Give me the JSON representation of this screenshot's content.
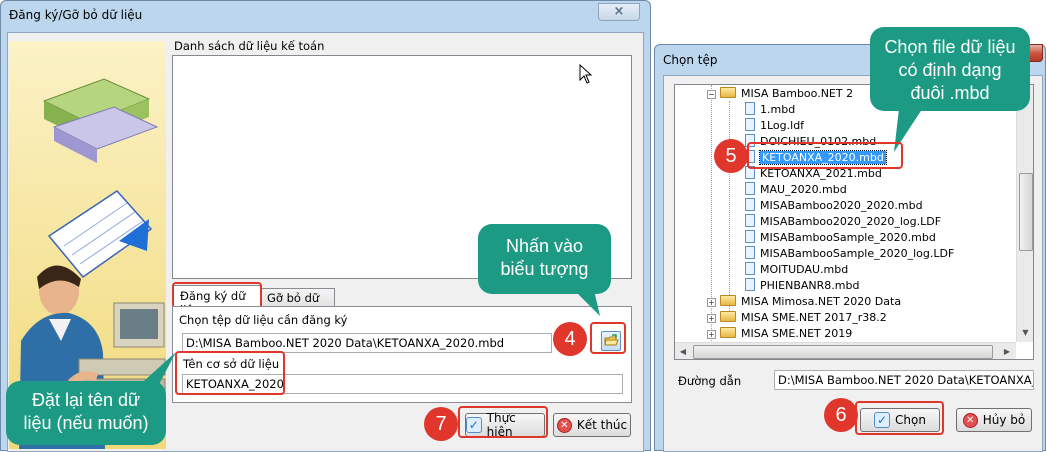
{
  "register_dialog": {
    "title": "Đăng ký/Gỡ bỏ dữ liệu",
    "close_icon": "×",
    "list_label": "Danh sách dữ liệu kế toán",
    "tabs": [
      {
        "label": "Đăng ký dữ liệu",
        "active": true
      },
      {
        "label": "Gỡ bỏ dữ liệu",
        "active": false
      }
    ],
    "file_field_label": "Chọn tệp dữ liệu cần đăng ký",
    "file_path_value": "D:\\MISA Bamboo.NET 2020 Data\\KETOANXA_2020.mbd",
    "db_name_label": "Tên cơ sở dữ liệu",
    "db_name_value": "KETOANXA_2020",
    "execute_button": "Thực hiện",
    "exit_button": "Kết thúc"
  },
  "choose_dialog": {
    "title": "Chọn tệp",
    "close_icon": "×",
    "tree": [
      {
        "label": "MISA Bamboo.NET 2",
        "type": "folder",
        "expander": "−"
      },
      {
        "label": "1.mbd",
        "type": "file"
      },
      {
        "label": "1Log.ldf",
        "type": "file"
      },
      {
        "label": "DOICHIEU_0102.mbd",
        "type": "file"
      },
      {
        "label": "KETOANXA_2020.mbd",
        "type": "file",
        "selected": true
      },
      {
        "label": "KETOANXA_2021.mbd",
        "type": "file"
      },
      {
        "label": "MAU_2020.mbd",
        "type": "file"
      },
      {
        "label": "MISABamboo2020_2020.mbd",
        "type": "file"
      },
      {
        "label": "MISABamboo2020_2020_log.LDF",
        "type": "file"
      },
      {
        "label": "MISABambooSample_2020.mbd",
        "type": "file"
      },
      {
        "label": "MISABambooSample_2020_log.LDF",
        "type": "file"
      },
      {
        "label": "MOITUDAU.mbd",
        "type": "file"
      },
      {
        "label": "PHIENBANR8.mbd",
        "type": "file"
      },
      {
        "label": "MISA Mimosa.NET 2020 Data",
        "type": "folder",
        "expander": "+"
      },
      {
        "label": "MISA SME.NET 2017_r38.2",
        "type": "folder",
        "expander": "+"
      },
      {
        "label": "MISA SME.NET 2019",
        "type": "folder",
        "expander": "+"
      }
    ],
    "path_label": "Đường dẫn",
    "path_value": "D:\\MISA Bamboo.NET 2020 Data\\KETOANXA_2020",
    "choose_button": "Chọn",
    "cancel_button": "Hủy bỏ"
  },
  "annotations": {
    "callout_choose_file": "Chọn file dữ liệu có định dạng đuôi .mbd",
    "callout_click_icon": "Nhấn vào biểu tượng",
    "callout_rename": "Đặt lại tên dữ liệu (nếu muốn)",
    "step_4": "4",
    "step_5": "5",
    "step_6": "6",
    "step_7": "7"
  },
  "colors": {
    "callout": "#1d9a83",
    "highlight": "#e0362c",
    "selection": "#3399ff"
  }
}
